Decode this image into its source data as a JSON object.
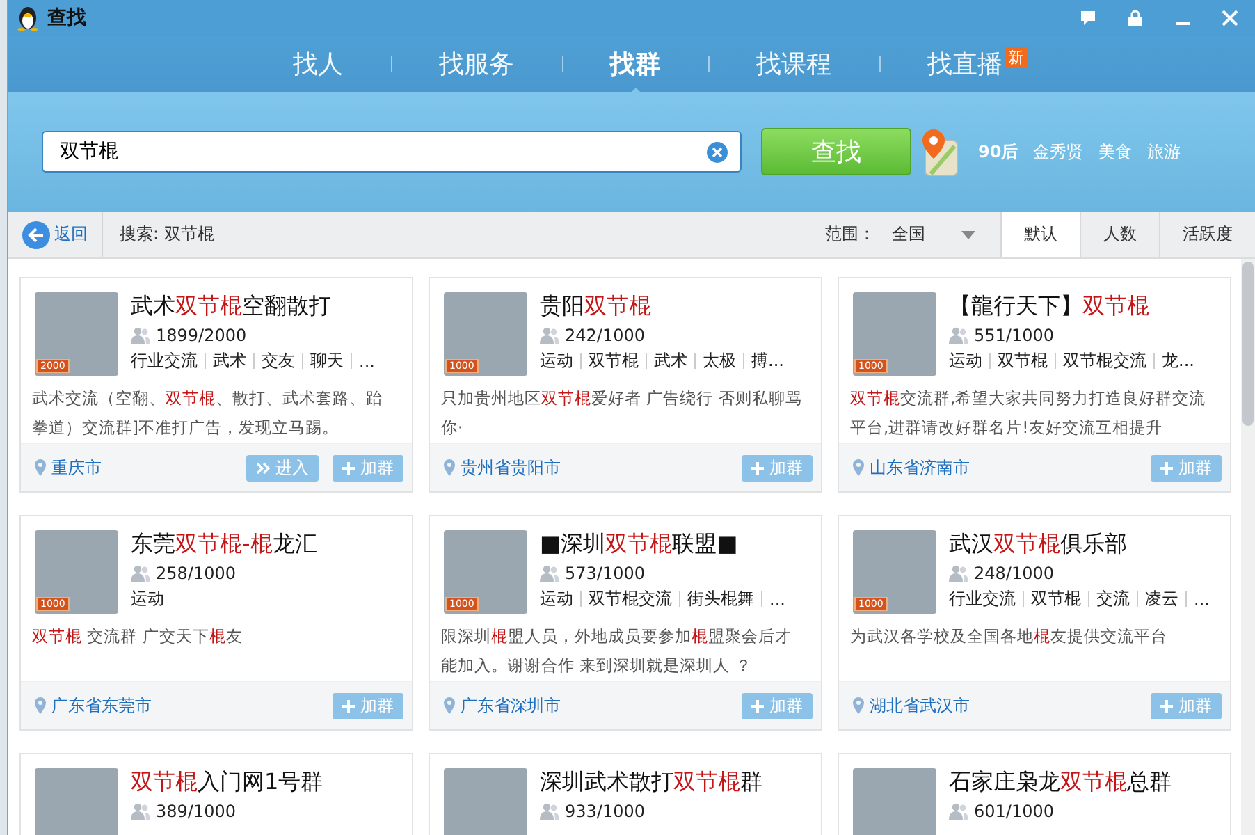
{
  "window": {
    "title": "查找"
  },
  "nav_tabs": [
    {
      "label": "找人",
      "selected": false
    },
    {
      "label": "找服务",
      "selected": false
    },
    {
      "label": "找群",
      "selected": true
    },
    {
      "label": "找课程",
      "selected": false
    },
    {
      "label": "找直播",
      "selected": false,
      "new_badge": "新"
    }
  ],
  "search": {
    "value": "双节棍",
    "button": "查找"
  },
  "hot_keywords": [
    {
      "label": "90后",
      "bold": true
    },
    {
      "label": "金秀贤",
      "bold": false
    },
    {
      "label": "美食",
      "bold": false
    },
    {
      "label": "旅游",
      "bold": false
    }
  ],
  "toolbar": {
    "back": "返回",
    "query": "搜索: 双节棍",
    "range_label": "范围：",
    "range_value": "全国",
    "sort_tabs": [
      {
        "label": "默认",
        "selected": true
      },
      {
        "label": "人数",
        "selected": false
      },
      {
        "label": "活跃度",
        "selected": false
      }
    ]
  },
  "groups": [
    {
      "title": "武术**双节棍**空翻散打",
      "level_badge": "2000",
      "members": "1899/2000",
      "tags": [
        "行业交流",
        "武术",
        "交友",
        "聊天",
        "..."
      ],
      "description": "武术交流（空翻、**双节棍**、散打、武术套路、跆拳道）交流群]不准打广告，发现立马踢。",
      "location": "重庆市",
      "enter_button": "进入",
      "join_button": "加群"
    },
    {
      "title": "贵阳**双节棍**",
      "level_badge": "1000",
      "members": "242/1000",
      "tags": [
        "运动",
        "双节棍",
        "武术",
        "太极",
        "搏..."
      ],
      "description": "只加贵州地区**双节棍**爱好者 广告绕行 否则私聊骂你·",
      "location": "贵州省贵阳市",
      "join_button": "加群"
    },
    {
      "title": "【龍行天下】**双节棍**",
      "level_badge": "1000",
      "members": "551/1000",
      "tags": [
        "运动",
        "双节棍",
        "双节棍交流",
        "龙..."
      ],
      "description": "**双节棍**交流群,希望大家共同努力打造良好群交流平台,进群请改好群名片!友好交流互相提升",
      "location": "山东省济南市",
      "join_button": "加群"
    },
    {
      "title": "东莞**双节棍-棍**龙汇",
      "level_badge": "1000",
      "members": "258/1000",
      "tags": [
        "运动"
      ],
      "description": "**双节棍** 交流群 广交天下**棍**友",
      "location": "广东省东莞市",
      "join_button": "加群"
    },
    {
      "title": "■深圳**双节棍**联盟■",
      "level_badge": "1000",
      "members": "573/1000",
      "tags": [
        "运动",
        "双节棍交流",
        "街头棍舞",
        "..."
      ],
      "description": "限深圳**棍**盟人员，外地成员要参加**棍**盟聚会后才能加入。谢谢合作 来到深圳就是深圳人 ？",
      "location": "广东省深圳市",
      "join_button": "加群"
    },
    {
      "title": "武汉**双节棍**俱乐部",
      "level_badge": "1000",
      "members": "248/1000",
      "tags": [
        "行业交流",
        "双节棍",
        "交流",
        "凌云",
        "..."
      ],
      "description": "为武汉各学校及全国各地**棍**友提供交流平台",
      "location": "湖北省武汉市",
      "join_button": "加群"
    },
    {
      "title": "**双节棍**入门网1号群",
      "members": "389/1000"
    },
    {
      "title": "深圳武术散打**双节棍**群",
      "members": "933/1000"
    },
    {
      "title": "石家庄枭龙**双节棍**总群",
      "members": "601/1000"
    }
  ]
}
